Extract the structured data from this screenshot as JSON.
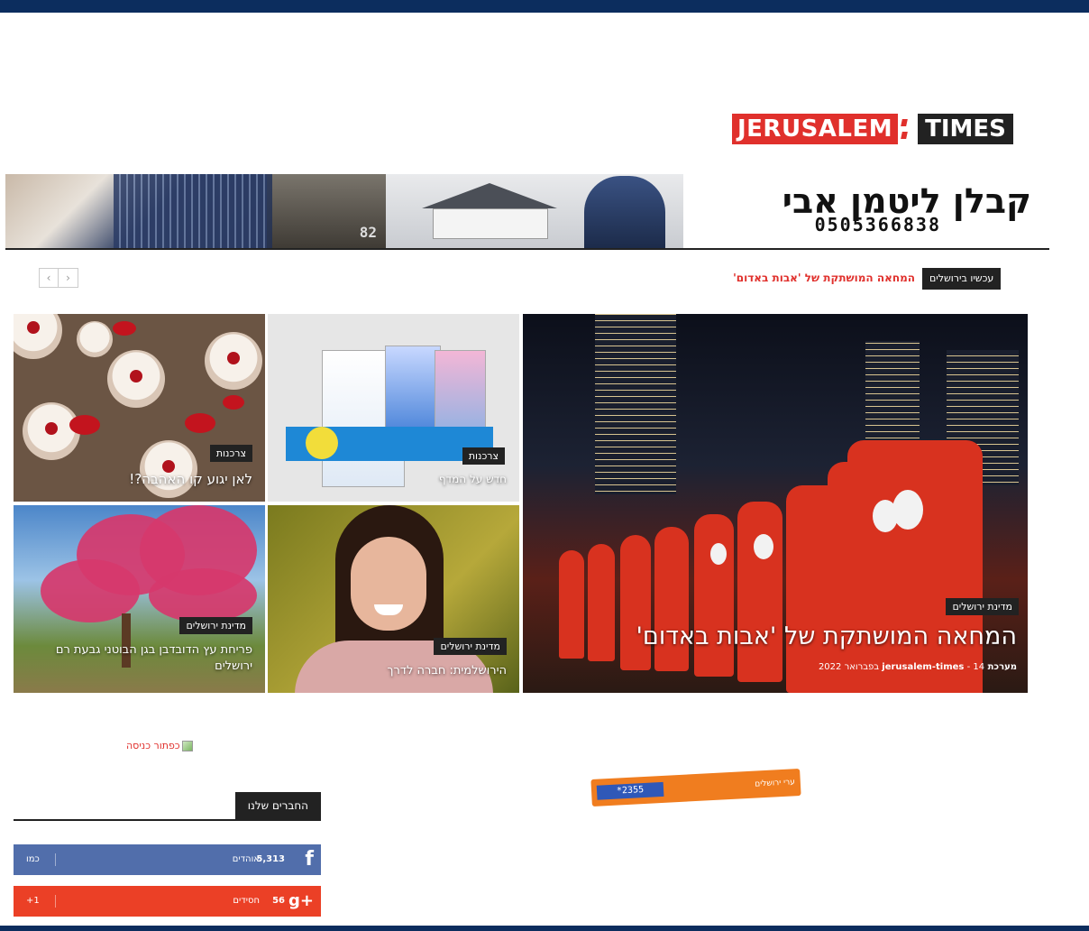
{
  "logo": {
    "part1": "JERUSALEM",
    "part2": "TIMES"
  },
  "banner": {
    "title": "קבלן ליטמן אבי",
    "phone": "0505366838",
    "plate_number": "82"
  },
  "ticker": {
    "label": "עכשיו בירושלים",
    "headline": "המחאה המושתקת של 'אבות באדום'",
    "prev": "‹",
    "next": "›"
  },
  "featured": {
    "main": {
      "tag": "מדינת ירושלים",
      "title": "המחאה המושתקת של 'אבות באדום'",
      "author": "מערכת jerusalem-times",
      "date": "14 בפברואר 2022"
    },
    "tooth": {
      "tag": "צרכנות",
      "title": "חדש על המדף"
    },
    "cake": {
      "tag": "צרכנות",
      "title": "לאן יגוע קו האהבה?!"
    },
    "girl": {
      "tag": "מדינת ירושלים",
      "title": "הירושלמית: חברה לדרך"
    },
    "tree": {
      "tag": "מדינת ירושלים",
      "title": "פריחת עץ הדובדבן בגן הבוטני גבעת רם ירושלים"
    }
  },
  "sidebar": {
    "broken_image_alt": "כפתור כניסה",
    "widget_title": "החברים שלנו",
    "facebook": {
      "count": "5,313",
      "unit": "אוהדים",
      "action": "כמו"
    },
    "googleplus": {
      "count": "56",
      "unit": "חסידים",
      "action": "1+"
    }
  },
  "ad": {
    "digits": "*2355",
    "text": "ערי ירושלים"
  },
  "colors": {
    "frame": "#0c2d5e",
    "accent_red": "#e0302c",
    "facebook": "#516eab",
    "googleplus": "#eb4026",
    "ad_orange": "#f07d1f"
  }
}
